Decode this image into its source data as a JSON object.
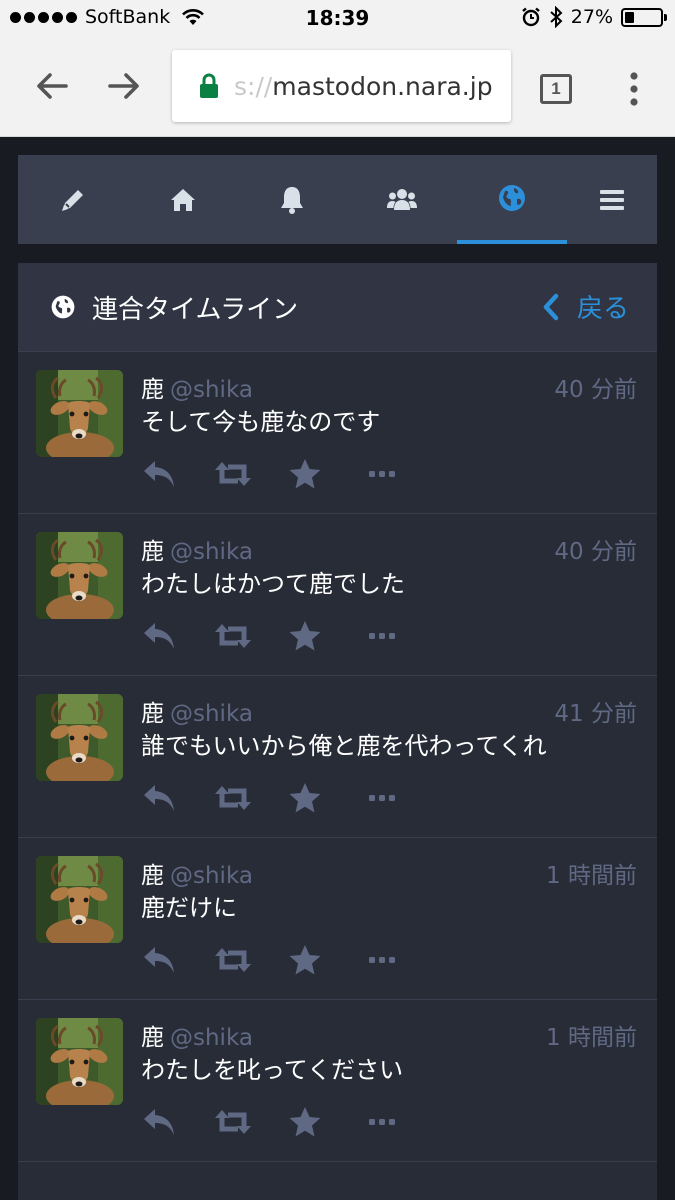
{
  "statusbar": {
    "carrier": "SoftBank",
    "time": "18:39",
    "battery": "27%",
    "battery_level": 0.27
  },
  "browser": {
    "url_scheme": "s://",
    "url_host": "mastodon.nara.jp",
    "tab_count": "1"
  },
  "tabs": [
    {
      "icon": "pencil-icon",
      "name": "compose"
    },
    {
      "icon": "home-icon",
      "name": "home"
    },
    {
      "icon": "bell-icon",
      "name": "notifications"
    },
    {
      "icon": "users-icon",
      "name": "local"
    },
    {
      "icon": "globe-icon",
      "name": "federated",
      "active": true
    },
    {
      "icon": "menu-icon",
      "name": "menu"
    }
  ],
  "column": {
    "title": "連合タイムライン",
    "back_label": "戻る"
  },
  "statuses": [
    {
      "display_name": "鹿",
      "acct": "@shika",
      "time": "40 分前",
      "content": "そして今も鹿なのです"
    },
    {
      "display_name": "鹿",
      "acct": "@shika",
      "time": "40 分前",
      "content": "わたしはかつて鹿でした"
    },
    {
      "display_name": "鹿",
      "acct": "@shika",
      "time": "41 分前",
      "content": "誰でもいいから俺と鹿を代わってくれ"
    },
    {
      "display_name": "鹿",
      "acct": "@shika",
      "time": "1 時間前",
      "content": "鹿だけに"
    },
    {
      "display_name": "鹿",
      "acct": "@shika",
      "time": "1 時間前",
      "content": "わたしを叱ってください"
    }
  ],
  "colors": {
    "accent": "#2b90d9",
    "action_icon": "#606984",
    "background": "#191b22",
    "column": "#282c37"
  }
}
